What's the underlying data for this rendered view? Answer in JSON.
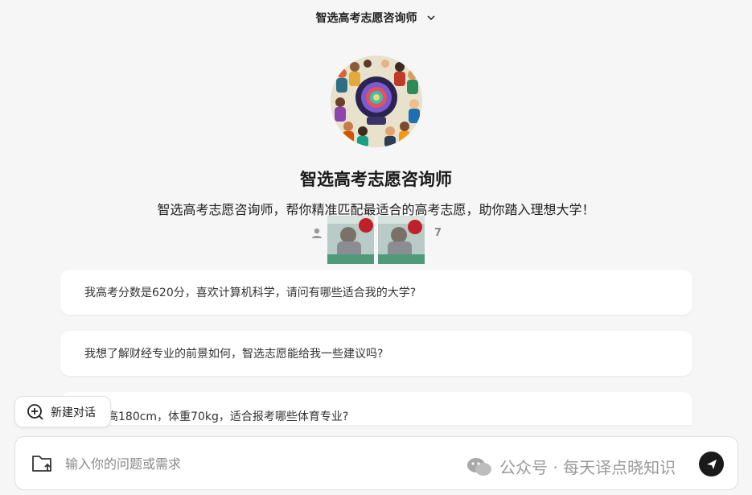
{
  "header": {
    "title": "智选高考志愿咨询师"
  },
  "agent": {
    "name": "智选高考志愿咨询师",
    "description": "智选高考志愿咨询师，帮你精准匹配最适合的高考志愿，助你踏入理想大学！",
    "user_count": "7"
  },
  "suggestions": [
    "我高考分数是620分，喜欢计算机科学，请问有哪些适合我的大学?",
    "我想了解财经专业的前景如何，智选志愿能给我一些建议吗?",
    "我身高180cm，体重70kg，适合报考哪些体育专业?"
  ],
  "new_chat": {
    "label": "新建对话"
  },
  "composer": {
    "placeholder": "输入你的问题或需求"
  },
  "watermark": {
    "text": "公众号 · 每天译点晓知识"
  },
  "icons": [
    "chevron-down-icon",
    "user-icon",
    "add-chat-icon",
    "folder-upload-icon",
    "send-icon",
    "wechat-icon"
  ]
}
